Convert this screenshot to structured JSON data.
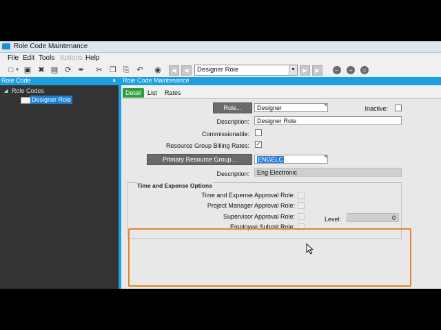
{
  "window": {
    "title": "Role Code Maintenance"
  },
  "menu": [
    {
      "label": "File",
      "enabled": true
    },
    {
      "label": "Edit",
      "enabled": true
    },
    {
      "label": "Tools",
      "enabled": true
    },
    {
      "label": "Actions",
      "enabled": false
    },
    {
      "label": "Help",
      "enabled": true
    }
  ],
  "toolbar": {
    "icons": [
      "new-icon",
      "save-icon",
      "delete-icon",
      "book-icon",
      "refresh-icon",
      "clear-icon",
      "cut-icon",
      "copy-icon",
      "paste-icon",
      "undo-icon",
      "binoculars-icon",
      "first-record-icon",
      "prev-record-icon",
      "next-record-icon",
      "last-record-icon",
      "back-icon",
      "forward-icon",
      "home-icon"
    ],
    "nav_value": "Designer Role"
  },
  "left_panel": {
    "title": "Role Code",
    "tree_root": "Role Codes",
    "selected_item": "Designer Role"
  },
  "right_panel": {
    "title": "Role Code Maintenance",
    "tabs": [
      "Detail",
      "List",
      "Rates"
    ],
    "active_tab": "Detail"
  },
  "form": {
    "role_button": "Role...",
    "role_value": "Designer",
    "inactive_label": "Inactive:",
    "inactive_checked": false,
    "description_label": "Description:",
    "description_value": "Designer Role",
    "commissionable_label": "Commissionable:",
    "commissionable_checked": false,
    "billing_rates_label": "Resource Group Billing Rates:",
    "billing_rates_checked": true,
    "primary_group_button": "Primary Resource Group...",
    "primary_group_value": "ENGELC",
    "group_description_label": "Description:",
    "group_description_value": "Eng Electronic"
  },
  "time_expense": {
    "group_title": "Time and Expense Options",
    "approval_role_label": "Time and Expense Approval Role:",
    "pm_approval_label": "Project Manager Approval Role:",
    "supervisor_label": "Supervisor Approval  Role:",
    "employee_submit_label": "Employee Submit Role:",
    "level_label": "Level:",
    "level_value": "0"
  },
  "colors": {
    "accent": "#1a9fdf",
    "tab_active": "#2e9e3e",
    "highlight": "#e0872a"
  }
}
